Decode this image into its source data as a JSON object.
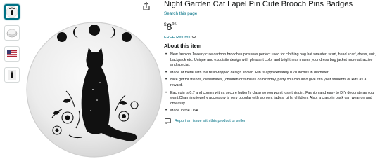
{
  "product": {
    "title": "Night Garden Cat Lapel Pin Cute Brooch Pins Badges",
    "store_link": "Search this page",
    "price_symbol": "$",
    "price_whole": "8",
    "price_fraction": "95",
    "returns": "FREE Returns",
    "about_heading": "About this item",
    "bullets": [
      "New fashion Jewelry cute cartoon brooches pins was perfect used for clothing bag hat sweater, scarf, head scarf, dress, suit, backpack etc. Unique and exquisite design with pleasant color and brightness makes your dress bag jacket more attractive and special.",
      "Made of metal with the resin-topped design shown. Pin is approximately 0.70 inches in diameter.",
      "Nice gift for friends, classmates, ,children or families on birthday, party.You can also give it to your students or kids as a reward.",
      "Each pin is 0.7 and comes with a secure butterfly clasp so you won't lose this pin. Fashion and easy to DIY decorate as you want.Charming jewelry accessory is very popular with women, ladies, girls, children. Also, a clasp in back can wear on and off easily.",
      "Made in the USA"
    ],
    "report_link": "Report an issue with this product or seller"
  },
  "icons": {
    "share": "share-icon",
    "chevron": "chevron-down-icon",
    "report": "message-icon"
  },
  "colors": {
    "link": "#007185",
    "text": "#0f1111",
    "thumb_active": "#007185"
  }
}
